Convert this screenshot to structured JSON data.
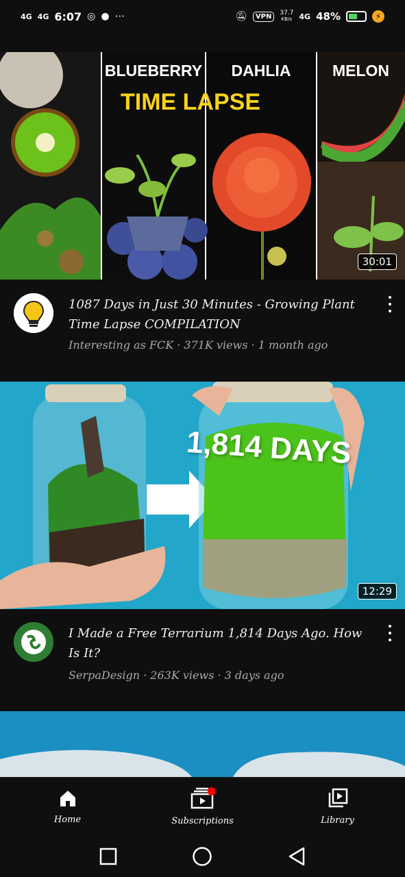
{
  "status_bar": {
    "signal1": "4G",
    "signal2": "4G",
    "time": "6:07",
    "vpn": "VPN",
    "net_speed_value": "37.7",
    "net_speed_unit": "KB/s",
    "signal3": "4G",
    "battery_percent": "48%",
    "battery_level": 0.48
  },
  "videos": [
    {
      "thumbnail_labels": [
        "BLUEBERRY",
        "DAHLIA",
        "MELON"
      ],
      "thumbnail_headline": "TIME LAPSE",
      "duration": "30:01",
      "title": "1087 Days in Just 30 Minutes - Growing Plant Time Lapse COMPILATION",
      "channel_line": "Interesting as FCK · 371K views · 1 month ago"
    },
    {
      "thumbnail_headline": "1,814 DAYS",
      "duration": "12:29",
      "title": "I Made a Free Terrarium 1,814 Days Ago. How Is It?",
      "channel_line": "SerpaDesign · 263K views · 3 days ago"
    }
  ],
  "bottom_nav": {
    "home": "Home",
    "subscriptions": "Subscriptions",
    "library": "Library"
  },
  "colors": {
    "background": "#0f0f0f",
    "notification_dot": "#ff0000",
    "battery_fill": "#4cd964"
  }
}
